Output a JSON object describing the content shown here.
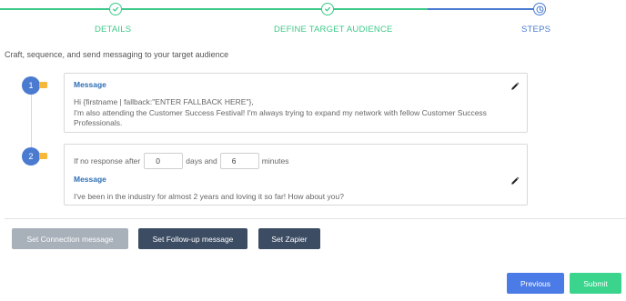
{
  "stepper": {
    "steps": [
      {
        "label": "DETAILS",
        "status": "complete"
      },
      {
        "label": "DEFINE TARGET AUDIENCE",
        "status": "complete"
      },
      {
        "label": "STEPS",
        "status": "current"
      }
    ],
    "colors": {
      "complete": "#3ec98a",
      "current": "#4a7bd0"
    }
  },
  "intro_text": "Craft, sequence, and send messaging to your target audience",
  "sequence": [
    {
      "number": "1",
      "message_title": "Message",
      "message_lines": [
        "Hi {firstname | fallback:\"ENTER FALLBACK HERE\"},",
        "I'm also attending the Customer Success Festival! I'm always trying to expand my network with fellow Customer Success",
        "Professionals."
      ],
      "edit_icon": "pencil-icon"
    },
    {
      "number": "2",
      "delay": {
        "prefix": "If no response after",
        "days_value": "0",
        "days_label": "days and",
        "minutes_value": "6",
        "minutes_label": "minutes"
      },
      "message_title": "Message",
      "message_lines": [
        "I've been in the industry for almost 2 years and loving it so far! How about you?"
      ],
      "edit_icon": "pencil-icon"
    }
  ],
  "actions": {
    "connection": "Set Connection message",
    "followup": "Set Follow-up message",
    "zapier": "Set Zapier"
  },
  "nav": {
    "previous": "Previous",
    "submit": "Submit"
  }
}
